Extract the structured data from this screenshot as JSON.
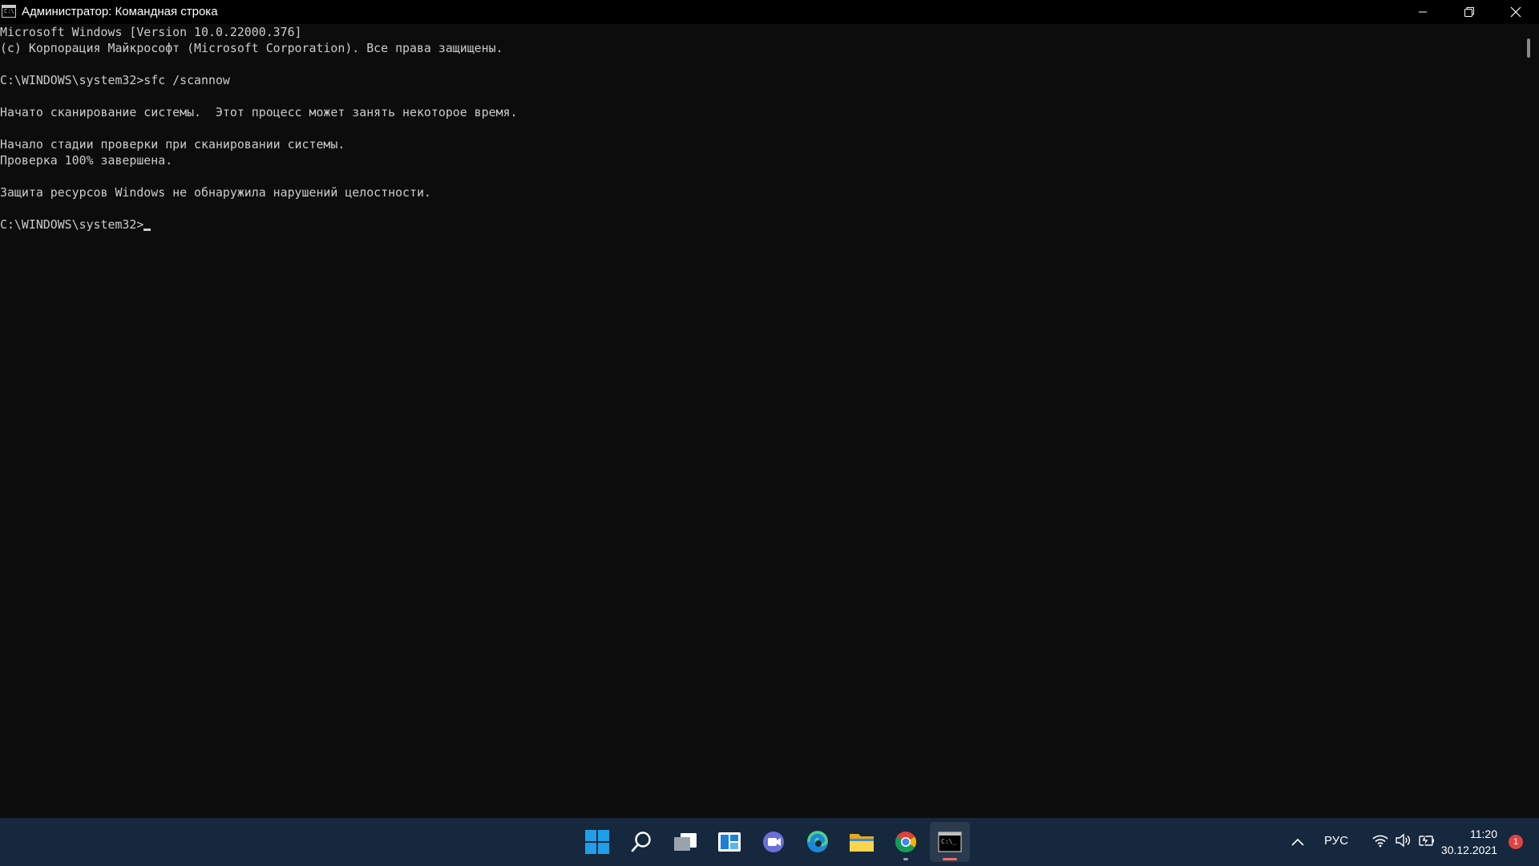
{
  "window": {
    "title": "Администратор: Командная строка",
    "icon_label": "C:\\"
  },
  "console": {
    "lines": [
      "Microsoft Windows [Version 10.0.22000.376]",
      "(c) Корпорация Майкрософт (Microsoft Corporation). Все права защищены.",
      "",
      "C:\\WINDOWS\\system32>sfc /scannow",
      "",
      "Начато сканирование системы.  Этот процесс может занять некоторое время.",
      "",
      "Начало стадии проверки при сканировании системы.",
      "Проверка 100% завершена.",
      "",
      "Защита ресурсов Windows не обнаружила нарушений целостности.",
      ""
    ],
    "prompt": "C:\\WINDOWS\\system32>"
  },
  "taskbar": {
    "apps": [
      {
        "name": "start-button",
        "icon": "windows-logo-icon"
      },
      {
        "name": "search-button",
        "icon": "search-icon"
      },
      {
        "name": "task-view-button",
        "icon": "task-view-icon"
      },
      {
        "name": "widgets-button",
        "icon": "widgets-icon"
      },
      {
        "name": "chat-button",
        "icon": "teams-chat-icon"
      },
      {
        "name": "edge-button",
        "icon": "edge-icon"
      },
      {
        "name": "file-explorer-button",
        "icon": "folder-icon"
      },
      {
        "name": "chrome-button",
        "icon": "chrome-icon"
      },
      {
        "name": "cmd-button",
        "icon": "cmd-icon"
      }
    ],
    "tray": {
      "language": "РУС",
      "time": "11:20",
      "date": "30.12.2021",
      "notification_count": "1"
    }
  },
  "colors": {
    "console_bg": "#0c0c0c",
    "console_text": "#cccccc",
    "titlebar_bg": "#000000",
    "taskbar_bg": "#16283d",
    "notification_badge": "#e04343"
  }
}
